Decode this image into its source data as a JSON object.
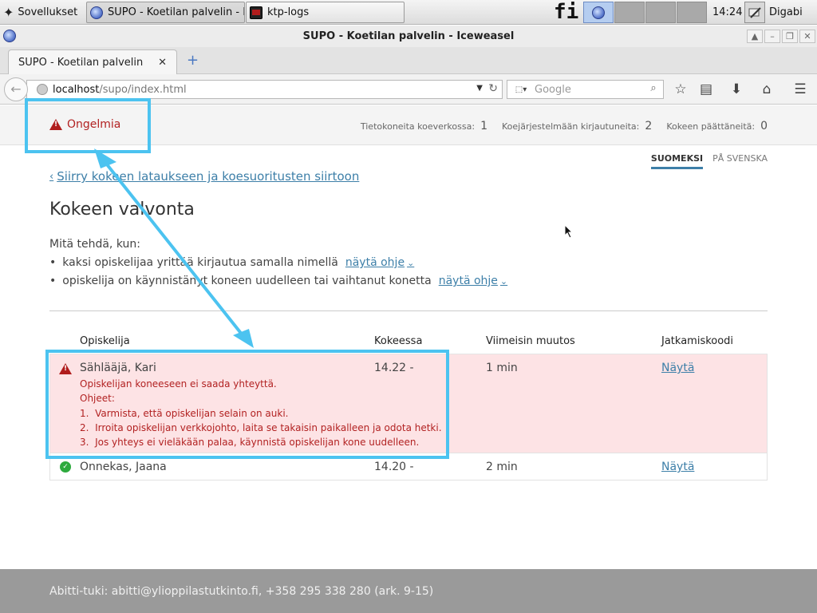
{
  "taskbar": {
    "apps_label": "Sovellukset",
    "task_browser": "SUPO - Koetilan palvelin - Ic...",
    "task_terminal": "ktp-logs",
    "keyboard_layout": "fi",
    "clock": "14:24",
    "os_name": "Digabi OS"
  },
  "window": {
    "title": "SUPO - Koetilan palvelin - Iceweasel"
  },
  "tab": {
    "label": "SUPO - Koetilan palvelin",
    "close": "✕",
    "new": "+"
  },
  "nav": {
    "url_host": "localhost",
    "url_path": "/supo/index.html",
    "search_placeholder": "Google"
  },
  "status": {
    "problems_label": "Ongelmia",
    "stat1_label": "Tietokoneita koeverkossa:",
    "stat1_value": "1",
    "stat2_label": "Koejärjestelmään kirjautuneita:",
    "stat2_value": "2",
    "stat3_label": "Kokeen päättäneitä:",
    "stat3_value": "0"
  },
  "lang": {
    "fi": "SUOMEKSI",
    "sv": "PÅ SVENSKA"
  },
  "main": {
    "back_link": "Siirry kokeen lataukseen ja koesuoritusten siirtoon",
    "heading": "Kokeen valvonta",
    "what_todo": "Mitä tehdä, kun:",
    "todo1": "kaksi opiskelijaa yrittää kirjautua samalla nimellä",
    "todo2": "opiskelija on käynnistänyt koneen uudelleen tai vaihtanut konetta",
    "help_link": "näytä ohje",
    "bullet": "•"
  },
  "table": {
    "headers": [
      "Opiskelija",
      "Kokeessa",
      "Viimeisin muutos",
      "Jatkamiskoodi"
    ],
    "rows": [
      {
        "name": "Sählääjä, Kari",
        "time": "14.22 -",
        "changed": "1 min",
        "code": "Näytä",
        "problem": "Opiskelijan koneeseen ei saada yhteyttä.",
        "instructions_title": "Ohjeet:",
        "instructions": [
          "1.  Varmista, että opiskelijan selain on auki.",
          "2.  Irroita opiskelijan verkkojohto, laita se takaisin paikalleen ja odota hetki.",
          "3.  Jos yhteys ei vieläkään palaa, käynnistä opiskelijan kone uudelleen."
        ]
      },
      {
        "name": "Onnekas, Jaana",
        "time": "14.20 -",
        "changed": "2 min",
        "code": "Näytä"
      }
    ]
  },
  "footer": {
    "text": "Abitti-tuki: abitti@ylioppilastutkinto.fi, +358 295 338 280 (ark. 9-15)"
  },
  "colors": {
    "link": "#3d7fa8",
    "problem": "#b22222",
    "problem_row_bg": "#fde3e5",
    "ok": "#2eaa3e",
    "annotation": "#4cc3f0",
    "footer_bg": "#9a9a9a"
  }
}
